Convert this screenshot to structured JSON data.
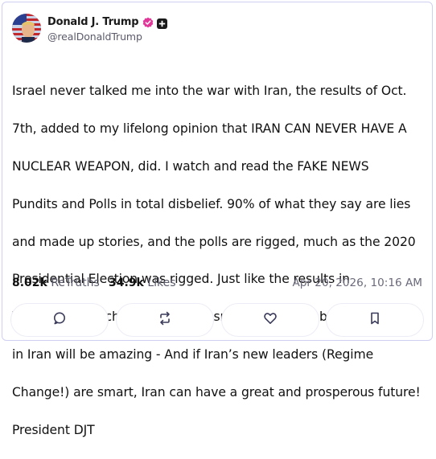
{
  "author": {
    "display_name": "Donald J. Trump",
    "handle": "@realDonaldTrump",
    "verified": true
  },
  "post": {
    "text": "Israel never talked me into the war with Iran, the results of Oct. 7th, added to my lifelong opinion that IRAN CAN NEVER HAVE A NUCLEAR WEAPON, did. I watch and read the FAKE NEWS Pundits and Polls in total disbelief. 90% of what they say are lies and made up stories, and the polls are rigged, much as the 2020 Presidential Election was rigged. Just like the results in Venezuela, which the media doesn’t like talking about, the results in Iran will be amazing - And if Iran’s new leaders (Regime Change!) are smart, Iran can have a great and prosperous future! President DJT",
    "lines": [
      "Israel never talked me into the war with Iran, the results of Oct.",
      "7th, added to my lifelong opinion that IRAN CAN NEVER HAVE A",
      "NUCLEAR WEAPON, did. I watch and read the FAKE NEWS",
      "Pundits and Polls in total disbelief. 90% of what they say are lies",
      "and made up stories, and the polls are rigged, much as the 2020",
      "Presidential Election was rigged. Just like the results in",
      "Venezuela, which the media doesn’t like talking about, the results",
      "in Iran will be amazing - And if Iran’s new leaders (Regime",
      "Change!) are smart, Iran can have a great and prosperous future!",
      "President DJT"
    ]
  },
  "stats": {
    "retruths_count": "8.02k",
    "retruths_label": "ReTruths",
    "likes_count": "34.9k",
    "likes_label": "Likes",
    "timestamp": "Apr 20, 2026, 10:16 AM"
  },
  "actions": [
    {
      "name": "reply",
      "icon": "comment-icon"
    },
    {
      "name": "retruth",
      "icon": "retruth-icon"
    },
    {
      "name": "like",
      "icon": "heart-icon"
    },
    {
      "name": "bookmark",
      "icon": "bookmark-icon"
    }
  ],
  "colors": {
    "border": "#cfcff2",
    "verified_badge": "#e0399a",
    "muted_text": "#5a5a6a",
    "icon": "#3a3a5a"
  }
}
